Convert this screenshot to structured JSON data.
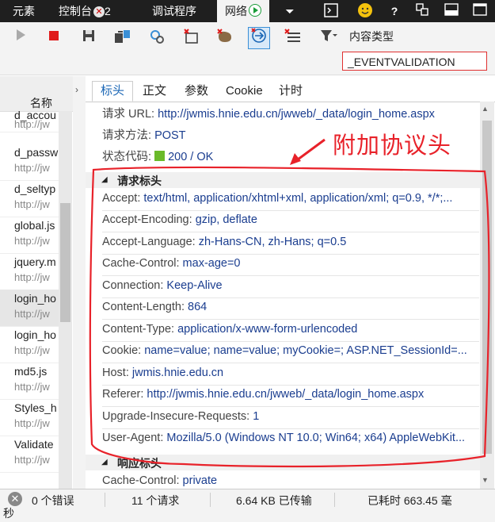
{
  "top_tabs": [
    {
      "label": "元素"
    },
    {
      "label": "控制台",
      "badge": "2"
    },
    {
      "label": "调试程序"
    },
    {
      "label": "网络"
    }
  ],
  "toolbar": {
    "content_type_label": "内容类型",
    "filter_value": "_EVENTVALIDATION"
  },
  "list": {
    "column_header": "名称",
    "items": [
      {
        "name": "d_accou",
        "url": "http://jw"
      },
      {
        "name": "d_passw",
        "url": "http://jw"
      },
      {
        "name": "d_seltyp",
        "url": "http://jw"
      },
      {
        "name": "global.js",
        "url": "http://jw"
      },
      {
        "name": "jquery.m",
        "url": "http://jw"
      },
      {
        "name": "login_ho",
        "url": "http://jw"
      },
      {
        "name": "login_ho",
        "url": "http://jw"
      },
      {
        "name": "md5.js",
        "url": "http://jw"
      },
      {
        "name": "Styles_h",
        "url": "http://jw"
      },
      {
        "name": "Validate",
        "url": "http://jw"
      }
    ]
  },
  "detail_tabs": [
    "标头",
    "正文",
    "参数",
    "Cookie",
    "计时"
  ],
  "general": {
    "url_key": "请求 URL:",
    "url_val": "http://jwmis.hnie.edu.cn/jwweb/_data/login_home.aspx",
    "method_key": "请求方法:",
    "method_val": "POST",
    "status_key": "状态代码:",
    "status_val": "200 / OK"
  },
  "request_headers_title": "请求标头",
  "request_headers": [
    {
      "k": "Accept:",
      "v": "text/html, application/xhtml+xml, application/xml; q=0.9, */*;..."
    },
    {
      "k": "Accept-Encoding:",
      "v": "gzip, deflate"
    },
    {
      "k": "Accept-Language:",
      "v": "zh-Hans-CN, zh-Hans; q=0.5"
    },
    {
      "k": "Cache-Control:",
      "v": "max-age=0"
    },
    {
      "k": "Connection:",
      "v": "Keep-Alive"
    },
    {
      "k": "Content-Length:",
      "v": "864"
    },
    {
      "k": "Content-Type:",
      "v": "application/x-www-form-urlencoded"
    },
    {
      "k": "Cookie:",
      "v": "name=value; name=value; myCookie=; ASP.NET_SessionId=..."
    },
    {
      "k": "Host:",
      "v": "jwmis.hnie.edu.cn"
    },
    {
      "k": "Referer:",
      "v": "http://jwmis.hnie.edu.cn/jwweb/_data/login_home.aspx"
    },
    {
      "k": "Upgrade-Insecure-Requests:",
      "v": "1"
    },
    {
      "k": "User-Agent:",
      "v": "Mozilla/5.0 (Windows NT 10.0; Win64; x64) AppleWebKit..."
    }
  ],
  "response_headers_title": "响应标头",
  "response_headers": [
    {
      "k": "Cache-Control:",
      "v": "private"
    }
  ],
  "annotation": "附加协议头",
  "status": {
    "errors": "0 个错误",
    "requests": "11 个请求",
    "transferred": "6.64 KB 已传输",
    "elapsed": "已耗时 663.45 毫",
    "elapsed_unit": "秒"
  },
  "colors": {
    "annotation": "#e8222a",
    "link": "#1a3d8f",
    "accent": "#1a66b5"
  }
}
